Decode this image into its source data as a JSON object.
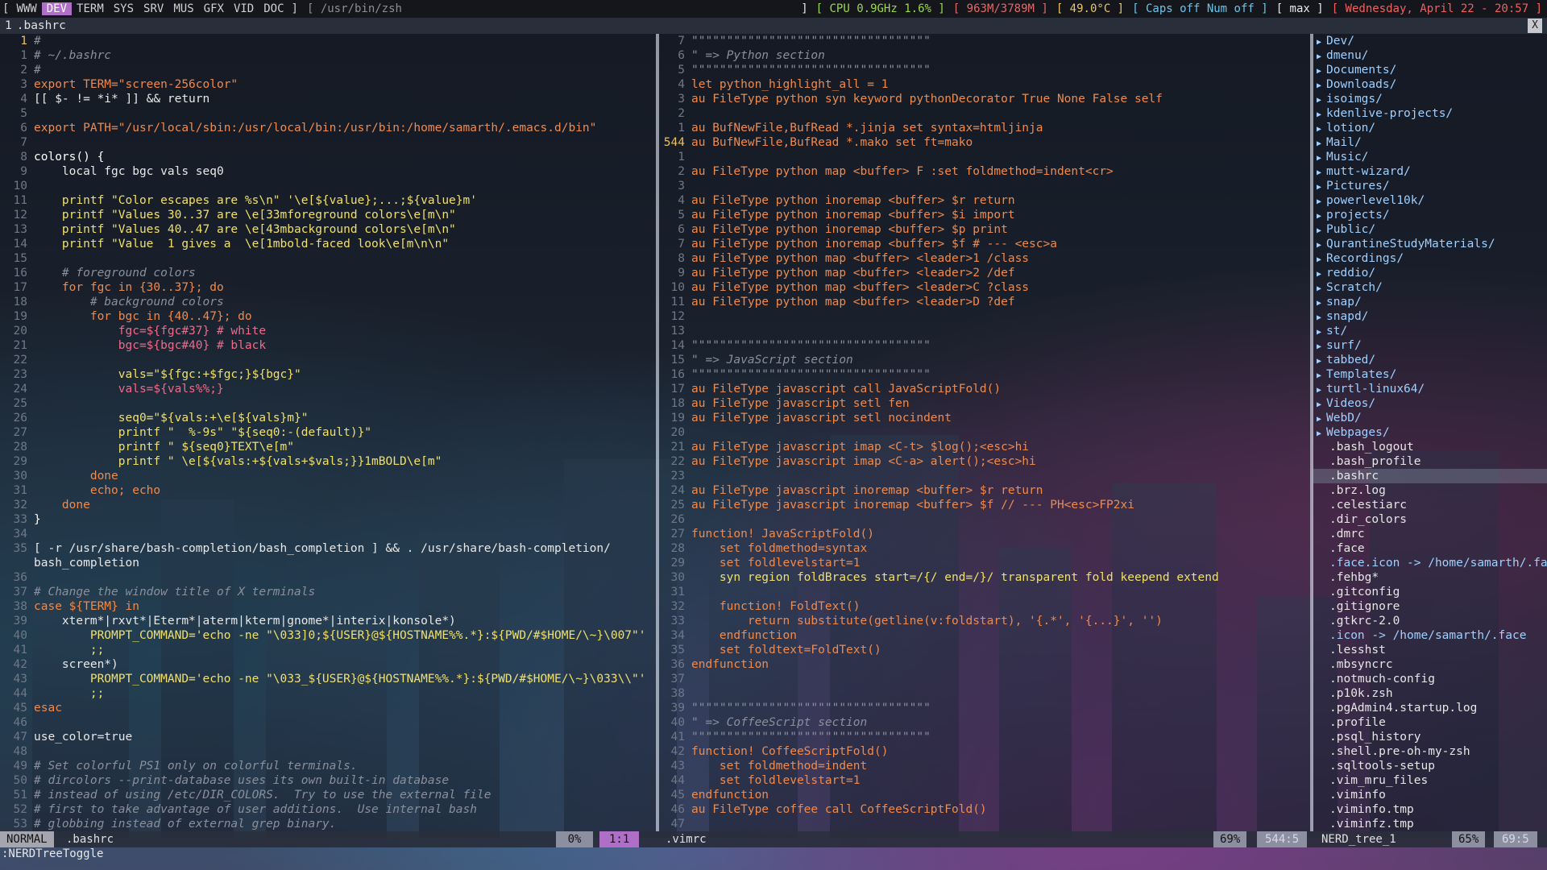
{
  "topbar": {
    "workspaces": [
      "WWW",
      "DEV",
      "TERM",
      "SYS",
      "SRV",
      "MUS",
      "GFX",
      "VID",
      "DOC"
    ],
    "active": "DEV",
    "path": "[ /usr/bin/zsh",
    "cpu": "[ CPU 0.9GHz 1.6% ]",
    "mem": "[ 963M/3789M ]",
    "temp": "[ 49.0°C ]",
    "locks": "[ Caps off Num off ]",
    "layout": "[ max ]",
    "date": "[ Wednesday, April 22 - 20:57 ]"
  },
  "tabline": {
    "num": "1",
    "name": ".bashrc",
    "close": "X"
  },
  "left": {
    "lines": [
      {
        "n": "1",
        "t": "#",
        "c": "cmt",
        "cur": true
      },
      {
        "n": "1",
        "t": "# ~/.bashrc",
        "c": "cmt"
      },
      {
        "n": "2",
        "t": "#",
        "c": "cmt"
      },
      {
        "n": "3",
        "t": "export TERM=\"screen-256color\"",
        "c": "kw"
      },
      {
        "n": "4",
        "t": "[[ $- != *i* ]] && return",
        "c": "code"
      },
      {
        "n": "5",
        "t": "",
        "c": "code"
      },
      {
        "n": "6",
        "t": "export PATH=\"/usr/local/sbin:/usr/local/bin:/usr/bin:/home/samarth/.emacs.d/bin\"",
        "c": "kw"
      },
      {
        "n": "7",
        "t": "",
        "c": "code"
      },
      {
        "n": "8",
        "t": "colors() {",
        "c": "fn"
      },
      {
        "n": "9",
        "t": "    local fgc bgc vals seq0",
        "c": "code"
      },
      {
        "n": "10",
        "t": "",
        "c": "code"
      },
      {
        "n": "11",
        "t": "    printf \"Color escapes are %s\\n\" '\\e[${value};...;${value}m'",
        "c": "str"
      },
      {
        "n": "12",
        "t": "    printf \"Values 30..37 are \\e[33mforeground colors\\e[m\\n\"",
        "c": "str"
      },
      {
        "n": "13",
        "t": "    printf \"Values 40..47 are \\e[43mbackground colors\\e[m\\n\"",
        "c": "str"
      },
      {
        "n": "14",
        "t": "    printf \"Value  1 gives a  \\e[1mbold-faced look\\e[m\\n\\n\"",
        "c": "str"
      },
      {
        "n": "15",
        "t": "",
        "c": "code"
      },
      {
        "n": "16",
        "t": "    # foreground colors",
        "c": "cmt"
      },
      {
        "n": "17",
        "t": "    for fgc in {30..37}; do",
        "c": "kw"
      },
      {
        "n": "18",
        "t": "        # background colors",
        "c": "cmt"
      },
      {
        "n": "19",
        "t": "        for bgc in {40..47}; do",
        "c": "kw"
      },
      {
        "n": "20",
        "t": "            fgc=${fgc#37} # white",
        "c": "var"
      },
      {
        "n": "21",
        "t": "            bgc=${bgc#40} # black",
        "c": "var"
      },
      {
        "n": "22",
        "t": "",
        "c": "code"
      },
      {
        "n": "23",
        "t": "            vals=\"${fgc:+$fgc;}${bgc}\"",
        "c": "str"
      },
      {
        "n": "24",
        "t": "            vals=${vals%%;}",
        "c": "var"
      },
      {
        "n": "25",
        "t": "",
        "c": "code"
      },
      {
        "n": "26",
        "t": "            seq0=\"${vals:+\\e[${vals}m}\"",
        "c": "str"
      },
      {
        "n": "27",
        "t": "            printf \"  %-9s\" \"${seq0:-(default)}\"",
        "c": "str"
      },
      {
        "n": "28",
        "t": "            printf \" ${seq0}TEXT\\e[m\"",
        "c": "str"
      },
      {
        "n": "29",
        "t": "            printf \" \\e[${vals:+${vals+$vals;}}1mBOLD\\e[m\"",
        "c": "str"
      },
      {
        "n": "30",
        "t": "        done",
        "c": "kw"
      },
      {
        "n": "31",
        "t": "        echo; echo",
        "c": "kw"
      },
      {
        "n": "32",
        "t": "    done",
        "c": "kw"
      },
      {
        "n": "33",
        "t": "}",
        "c": "fn"
      },
      {
        "n": "34",
        "t": "",
        "c": "code"
      },
      {
        "n": "35",
        "t": "[ -r /usr/share/bash-completion/bash_completion ] && . /usr/share/bash-completion/",
        "c": "code"
      },
      {
        "n": "",
        "t": "bash_completion",
        "c": "code"
      },
      {
        "n": "36",
        "t": "",
        "c": "code"
      },
      {
        "n": "37",
        "t": "# Change the window title of X terminals",
        "c": "cmt"
      },
      {
        "n": "38",
        "t": "case ${TERM} in",
        "c": "kw"
      },
      {
        "n": "39",
        "t": "    xterm*|rxvt*|Eterm*|aterm|kterm|gnome*|interix|konsole*)",
        "c": "code"
      },
      {
        "n": "40",
        "t": "        PROMPT_COMMAND='echo -ne \"\\033]0;${USER}@${HOSTNAME%%.*}:${PWD/#$HOME/\\~}\\007\"'",
        "c": "str"
      },
      {
        "n": "41",
        "t": "        ;;",
        "c": "str"
      },
      {
        "n": "42",
        "t": "    screen*)",
        "c": "code"
      },
      {
        "n": "43",
        "t": "        PROMPT_COMMAND='echo -ne \"\\033_${USER}@${HOSTNAME%%.*}:${PWD/#$HOME/\\~}\\033\\\\\"'",
        "c": "str"
      },
      {
        "n": "44",
        "t": "        ;;",
        "c": "str"
      },
      {
        "n": "45",
        "t": "esac",
        "c": "kw"
      },
      {
        "n": "46",
        "t": "",
        "c": "code"
      },
      {
        "n": "47",
        "t": "use_color=true",
        "c": "code"
      },
      {
        "n": "48",
        "t": "",
        "c": "code"
      },
      {
        "n": "49",
        "t": "# Set colorful PS1 only on colorful terminals.",
        "c": "cmt"
      },
      {
        "n": "50",
        "t": "# dircolors --print-database uses its own built-in database",
        "c": "cmt"
      },
      {
        "n": "51",
        "t": "# instead of using /etc/DIR_COLORS.  Try to use the external file",
        "c": "cmt"
      },
      {
        "n": "52",
        "t": "# first to take advantage of user additions.  Use internal bash",
        "c": "cmt"
      },
      {
        "n": "53",
        "t": "# globbing instead of external grep binary.",
        "c": "cmt"
      }
    ]
  },
  "mid": {
    "lines": [
      {
        "n": "7",
        "t": "\"\"\"\"\"\"\"\"\"\"\"\"\"\"\"\"\"\"\"\"\"\"\"\"\"\"\"\"\"\"\"\"\"\"",
        "c": "cmt"
      },
      {
        "n": "6",
        "t": "\" => Python section",
        "c": "cmt"
      },
      {
        "n": "5",
        "t": "\"\"\"\"\"\"\"\"\"\"\"\"\"\"\"\"\"\"\"\"\"\"\"\"\"\"\"\"\"\"\"\"\"\"",
        "c": "cmt"
      },
      {
        "n": "4",
        "t": "let python_highlight_all = 1",
        "c": "kw"
      },
      {
        "n": "3",
        "t": "au FileType python syn keyword pythonDecorator True None False self",
        "c": "kw"
      },
      {
        "n": "2",
        "t": "",
        "c": "code"
      },
      {
        "n": "1",
        "t": "au BufNewFile,BufRead *.jinja set syntax=htmljinja",
        "c": "kw"
      },
      {
        "n": "544",
        "t": "au BufNewFile,BufRead *.mako set ft=mako",
        "c": "kw",
        "cur": true
      },
      {
        "n": "1",
        "t": "",
        "c": "code"
      },
      {
        "n": "2",
        "t": "au FileType python map <buffer> F :set foldmethod=indent<cr>",
        "c": "kw"
      },
      {
        "n": "3",
        "t": "",
        "c": "code"
      },
      {
        "n": "4",
        "t": "au FileType python inoremap <buffer> $r return",
        "c": "kw"
      },
      {
        "n": "5",
        "t": "au FileType python inoremap <buffer> $i import",
        "c": "kw"
      },
      {
        "n": "6",
        "t": "au FileType python inoremap <buffer> $p print",
        "c": "kw"
      },
      {
        "n": "7",
        "t": "au FileType python inoremap <buffer> $f # --- <esc>a",
        "c": "kw"
      },
      {
        "n": "8",
        "t": "au FileType python map <buffer> <leader>1 /class",
        "c": "kw"
      },
      {
        "n": "9",
        "t": "au FileType python map <buffer> <leader>2 /def",
        "c": "kw"
      },
      {
        "n": "10",
        "t": "au FileType python map <buffer> <leader>C ?class",
        "c": "kw"
      },
      {
        "n": "11",
        "t": "au FileType python map <buffer> <leader>D ?def",
        "c": "kw"
      },
      {
        "n": "12",
        "t": "",
        "c": "code"
      },
      {
        "n": "13",
        "t": "",
        "c": "code"
      },
      {
        "n": "14",
        "t": "\"\"\"\"\"\"\"\"\"\"\"\"\"\"\"\"\"\"\"\"\"\"\"\"\"\"\"\"\"\"\"\"\"\"",
        "c": "cmt"
      },
      {
        "n": "15",
        "t": "\" => JavaScript section",
        "c": "cmt"
      },
      {
        "n": "16",
        "t": "\"\"\"\"\"\"\"\"\"\"\"\"\"\"\"\"\"\"\"\"\"\"\"\"\"\"\"\"\"\"\"\"\"\"",
        "c": "cmt"
      },
      {
        "n": "17",
        "t": "au FileType javascript call JavaScriptFold()",
        "c": "kw"
      },
      {
        "n": "18",
        "t": "au FileType javascript setl fen",
        "c": "kw"
      },
      {
        "n": "19",
        "t": "au FileType javascript setl nocindent",
        "c": "kw"
      },
      {
        "n": "20",
        "t": "",
        "c": "code"
      },
      {
        "n": "21",
        "t": "au FileType javascript imap <C-t> $log();<esc>hi",
        "c": "kw"
      },
      {
        "n": "22",
        "t": "au FileType javascript imap <C-a> alert();<esc>hi",
        "c": "kw"
      },
      {
        "n": "23",
        "t": "",
        "c": "code"
      },
      {
        "n": "24",
        "t": "au FileType javascript inoremap <buffer> $r return",
        "c": "kw"
      },
      {
        "n": "25",
        "t": "au FileType javascript inoremap <buffer> $f // --- PH<esc>FP2xi",
        "c": "kw"
      },
      {
        "n": "26",
        "t": "",
        "c": "code"
      },
      {
        "n": "27",
        "t": "function! JavaScriptFold()",
        "c": "kw"
      },
      {
        "n": "28",
        "t": "    set foldmethod=syntax",
        "c": "kw"
      },
      {
        "n": "29",
        "t": "    set foldlevelstart=1",
        "c": "kw"
      },
      {
        "n": "30",
        "t": "    syn region foldBraces start=/{/ end=/}/ transparent fold keepend extend",
        "c": "str"
      },
      {
        "n": "31",
        "t": "",
        "c": "code"
      },
      {
        "n": "32",
        "t": "    function! FoldText()",
        "c": "kw"
      },
      {
        "n": "33",
        "t": "        return substitute(getline(v:foldstart), '{.*', '{...}', '')",
        "c": "kw"
      },
      {
        "n": "34",
        "t": "    endfunction",
        "c": "kw"
      },
      {
        "n": "35",
        "t": "    set foldtext=FoldText()",
        "c": "kw"
      },
      {
        "n": "36",
        "t": "endfunction",
        "c": "kw"
      },
      {
        "n": "37",
        "t": "",
        "c": "code"
      },
      {
        "n": "38",
        "t": "",
        "c": "code"
      },
      {
        "n": "39",
        "t": "\"\"\"\"\"\"\"\"\"\"\"\"\"\"\"\"\"\"\"\"\"\"\"\"\"\"\"\"\"\"\"\"\"\"",
        "c": "cmt"
      },
      {
        "n": "40",
        "t": "\" => CoffeeScript section",
        "c": "cmt"
      },
      {
        "n": "41",
        "t": "\"\"\"\"\"\"\"\"\"\"\"\"\"\"\"\"\"\"\"\"\"\"\"\"\"\"\"\"\"\"\"\"\"\"",
        "c": "cmt"
      },
      {
        "n": "42",
        "t": "function! CoffeeScriptFold()",
        "c": "kw"
      },
      {
        "n": "43",
        "t": "    set foldmethod=indent",
        "c": "kw"
      },
      {
        "n": "44",
        "t": "    set foldlevelstart=1",
        "c": "kw"
      },
      {
        "n": "45",
        "t": "endfunction",
        "c": "kw"
      },
      {
        "n": "46",
        "t": "au FileType coffee call CoffeeScriptFold()",
        "c": "kw"
      },
      {
        "n": "47",
        "t": "",
        "c": "code"
      }
    ]
  },
  "tree": {
    "dirs": [
      "Dev/",
      "dmenu/",
      "Documents/",
      "Downloads/",
      "isoimgs/",
      "kdenlive-projects/",
      "lotion/",
      "Mail/",
      "Music/",
      "mutt-wizard/",
      "Pictures/",
      "powerlevel10k/",
      "projects/",
      "Public/",
      "QurantineStudyMaterials/",
      "Recordings/",
      "reddio/",
      "Scratch/",
      "snap/",
      "snapd/",
      "st/",
      "surf/",
      "tabbed/",
      "Templates/",
      "turtl-linux64/",
      "Videos/",
      "WebD/",
      "Webpages/"
    ],
    "files": [
      ".bash_logout",
      ".bash_profile",
      ".bashrc",
      ".brz.log",
      ".celestiarc",
      ".dir_colors",
      ".dmrc",
      ".face",
      ".face.icon -> /home/samarth/.face",
      ".fehbg*",
      ".gitconfig",
      ".gitignore",
      ".gtkrc-2.0",
      ".icon -> /home/samarth/.face",
      ".lesshst",
      ".mbsyncrc",
      ".notmuch-config",
      ".p10k.zsh",
      ".pgAdmin4.startup.log",
      ".profile",
      ".psql_history",
      ".shell.pre-oh-my-zsh",
      ".sqltools-setup",
      ".vim_mru_files",
      ".viminfo",
      ".viminfo.tmp",
      ".viminfz.tmp"
    ],
    "selected": ".bashrc"
  },
  "status": {
    "mode": "NORMAL",
    "left_file": ".bashrc",
    "left_pct": "0%",
    "left_pos": "1:1",
    "mid_file": ".vimrc",
    "mid_pct": "69%",
    "mid_pos": "544:5",
    "tree_name": "NERD_tree_1",
    "tree_pct": "65%",
    "tree_pos": "69:5"
  },
  "cmdline": ":NERDTreeToggle"
}
